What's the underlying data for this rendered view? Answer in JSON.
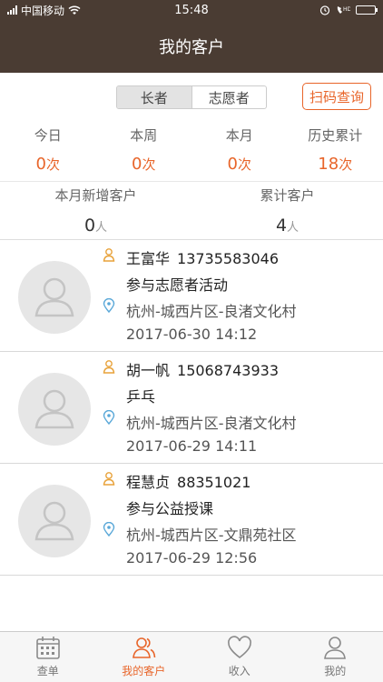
{
  "status_bar": {
    "carrier": "中国移动",
    "time": "15:48"
  },
  "header": {
    "title": "我的客户"
  },
  "toolbar": {
    "segments": [
      {
        "label": "长者",
        "active": true
      },
      {
        "label": "志愿者",
        "active": false
      }
    ],
    "scan_label": "扫码查询"
  },
  "stats": [
    {
      "label": "今日",
      "value": "0",
      "unit": "次"
    },
    {
      "label": "本周",
      "value": "0",
      "unit": "次"
    },
    {
      "label": "本月",
      "value": "0",
      "unit": "次"
    },
    {
      "label": "历史累计",
      "value": "18",
      "unit": "次"
    }
  ],
  "totals": [
    {
      "label": "本月新增客户",
      "value": "0",
      "unit": "人"
    },
    {
      "label": "累计客户",
      "value": "4",
      "unit": "人"
    }
  ],
  "customers": [
    {
      "name": "王富华",
      "phone": "13735583046",
      "activity": "参与志愿者活动",
      "location": "杭州-城西片区-良渚文化村",
      "datetime": "2017-06-30  14:12"
    },
    {
      "name": "胡一帆",
      "phone": "15068743933",
      "activity": "乒乓",
      "location": "杭州-城西片区-良渚文化村",
      "datetime": "2017-06-29  14:11"
    },
    {
      "name": "程慧贞",
      "phone": "88351021",
      "activity": "参与公益授课",
      "location": "杭州-城西片区-文鼎苑社区",
      "datetime": "2017-06-29  12:56"
    }
  ],
  "tabbar": [
    {
      "label": "查单",
      "icon": "calendar-icon",
      "active": false
    },
    {
      "label": "我的客户",
      "icon": "users-icon",
      "active": true
    },
    {
      "label": "收入",
      "icon": "heart-icon",
      "active": false
    },
    {
      "label": "我的",
      "icon": "person-icon",
      "active": false
    }
  ],
  "colors": {
    "accent": "#e8652a",
    "header_bg": "#4a3c33",
    "person_icon": "#e8a23a",
    "pin_icon": "#5aa8d8"
  }
}
